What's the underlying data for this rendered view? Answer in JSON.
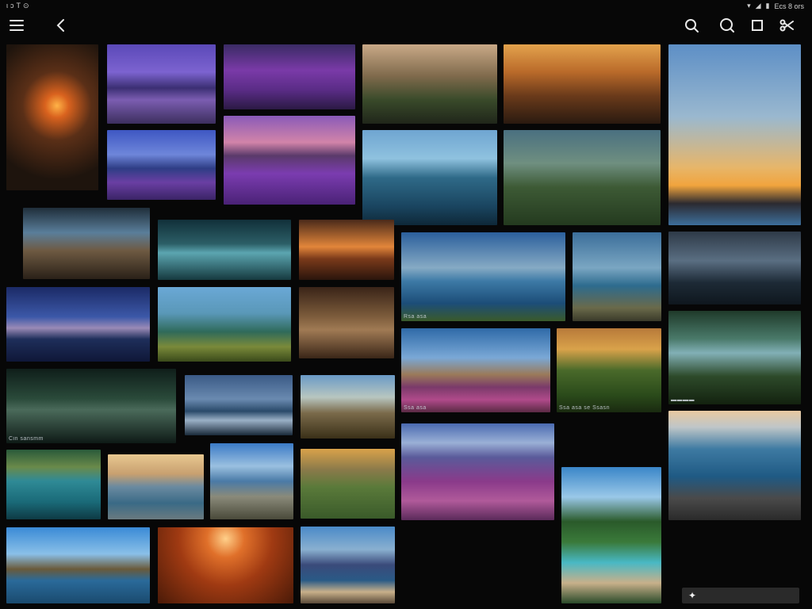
{
  "status_bar": {
    "left_icons": [
      "notification-icon",
      "sync-icon",
      "cloud-icon",
      "wifi-icon"
    ],
    "right_text": "Ecs 8 ors"
  },
  "toolbar": {
    "menu_icon": "menu-icon",
    "back_icon": "back-arrow-icon",
    "actions": [
      "search-icon",
      "zoom-icon",
      "select-square-icon",
      "scissors-icon"
    ]
  },
  "captions": {
    "tile_13": "Rsa asa",
    "tile_21": "Cin sansmm",
    "tile_29": "Ssa asa",
    "tile_30": "Ssa asa",
    "tile_31": "Ssa asa se Ssasn"
  },
  "fab": {
    "icon_glyph": "✦"
  },
  "palette": {
    "background": "#070707",
    "tile_purple": "#7a3aa8",
    "tile_blue": "#2f6aa8",
    "tile_orange": "#c0602a"
  }
}
